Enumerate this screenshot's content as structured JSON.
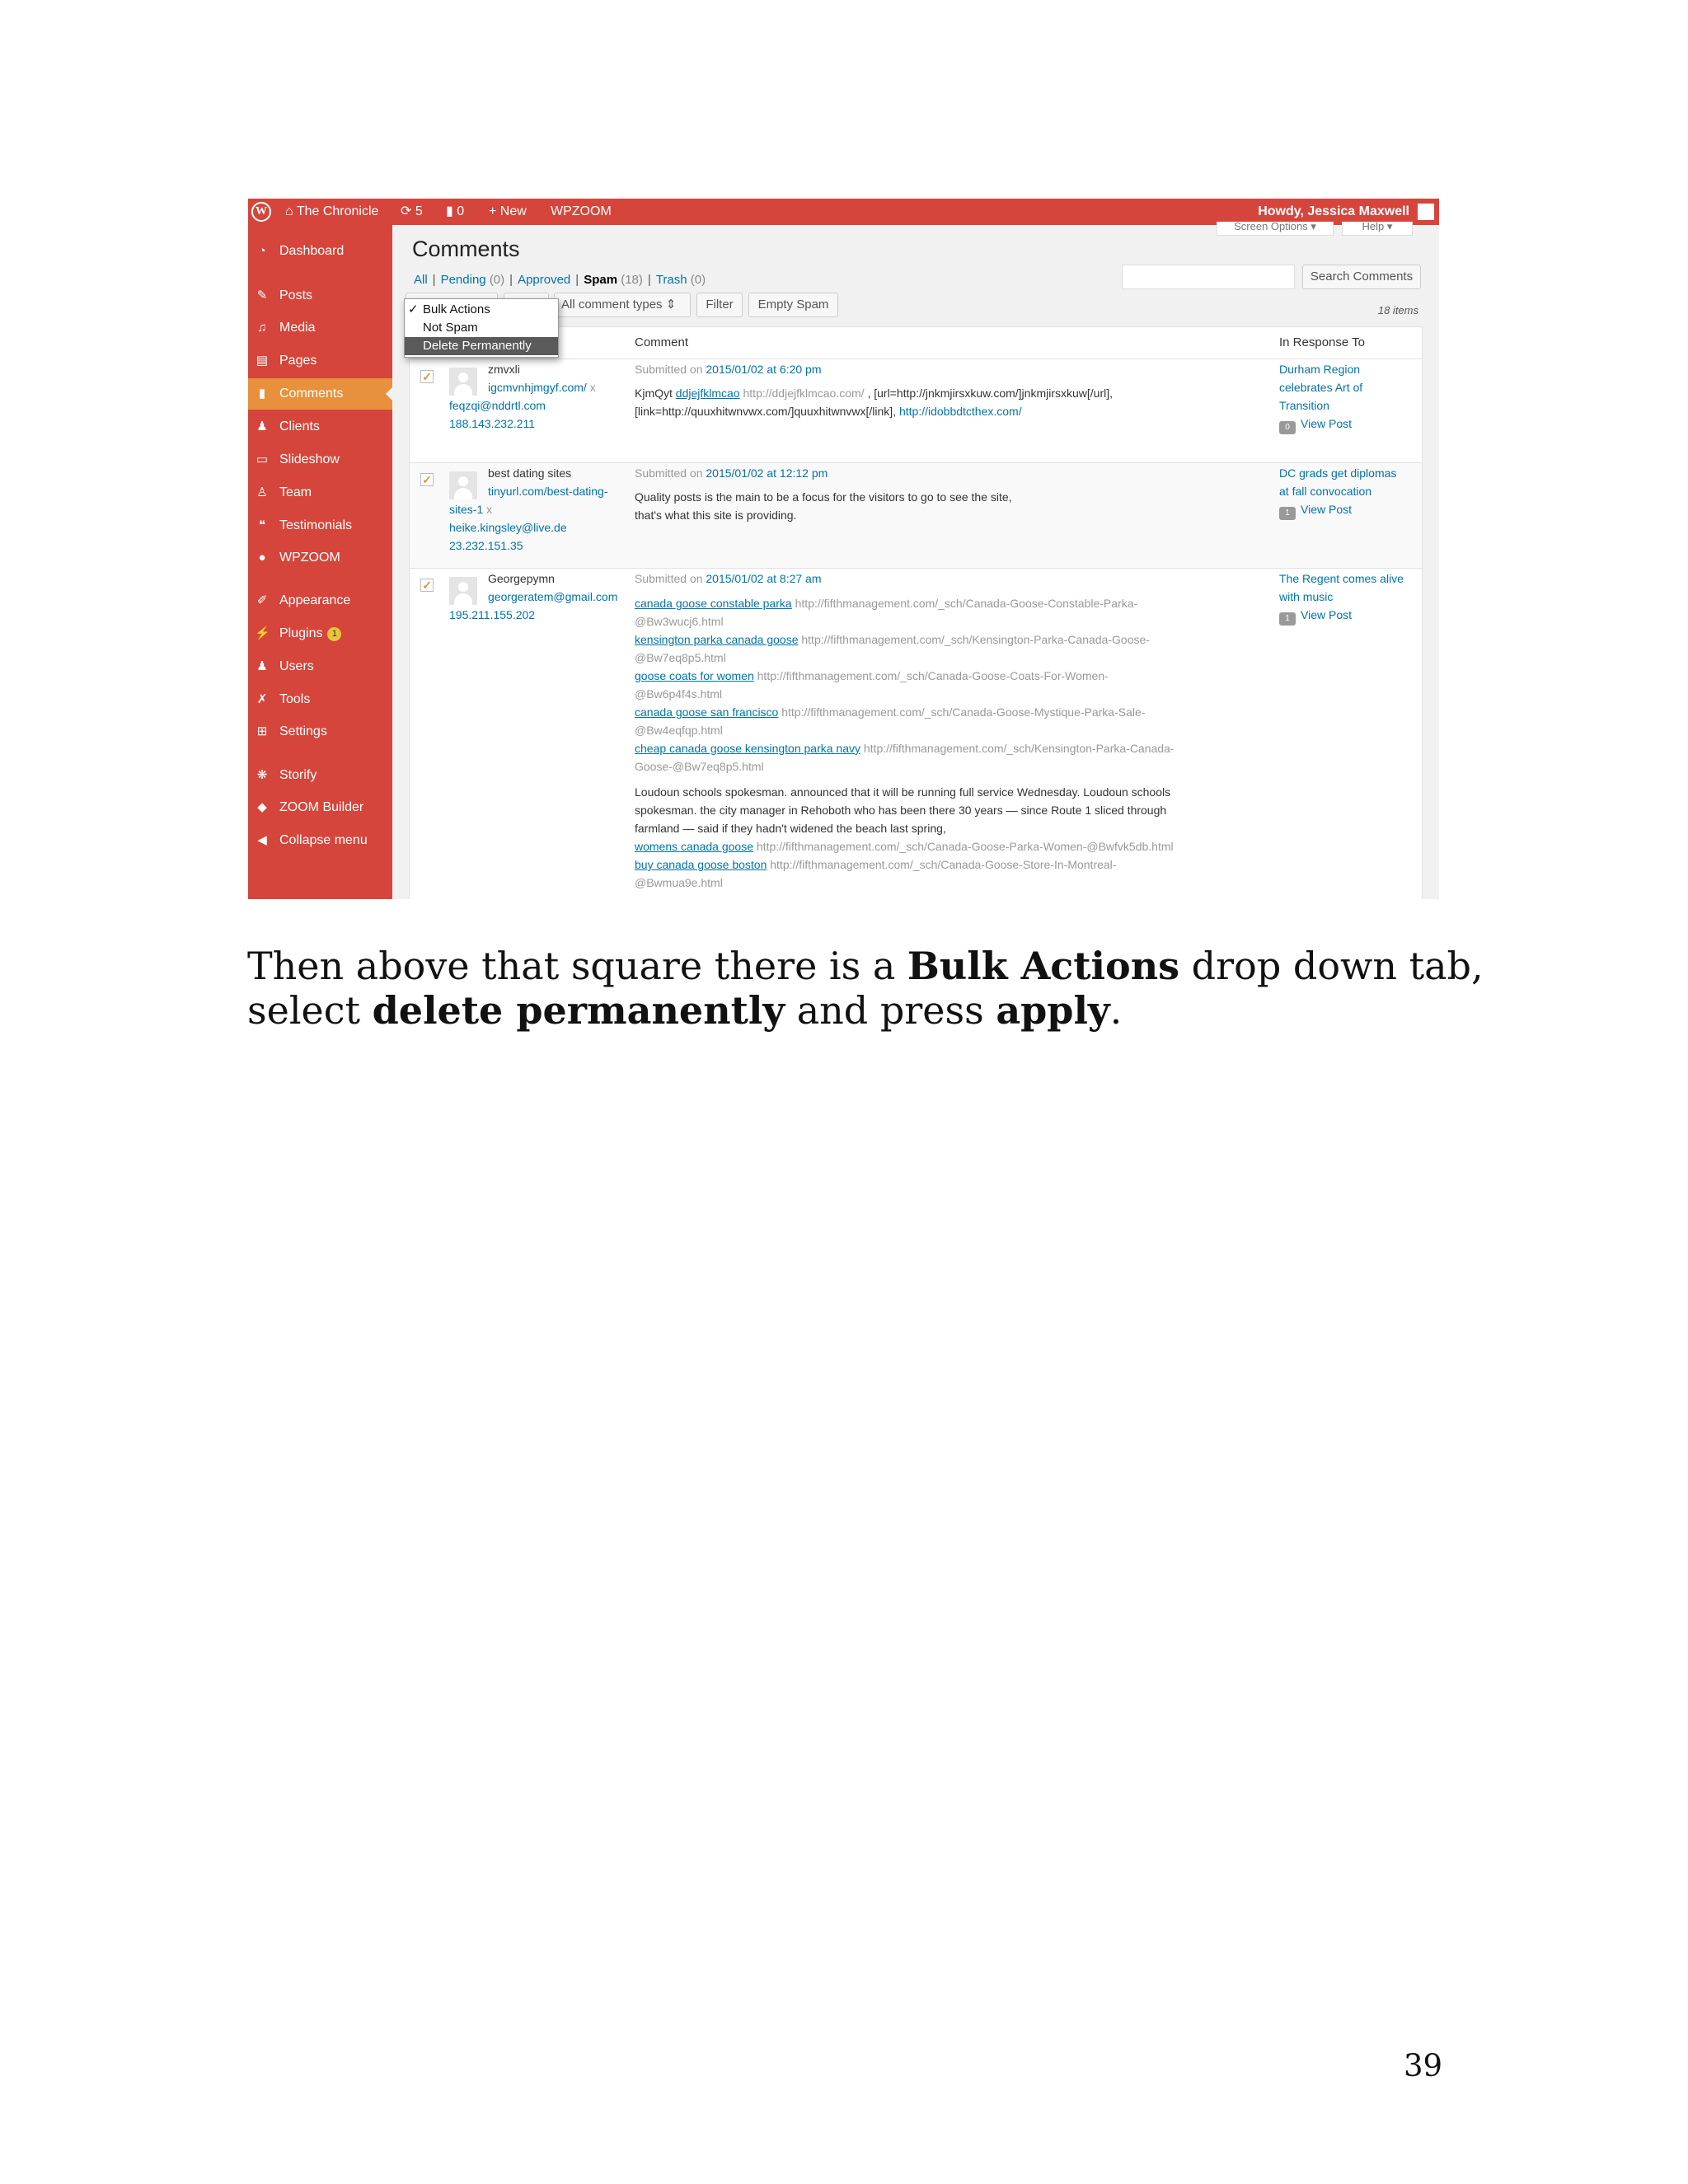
{
  "adminbar": {
    "site": "The Chronicle",
    "updates": "5",
    "comments": "0",
    "new": "New",
    "wpzoom": "WPZOOM",
    "howdy": "Howdy, Jessica Maxwell"
  },
  "sidebar": {
    "items": [
      {
        "label": "Dashboard",
        "icon": "dashboard-icon"
      },
      {
        "label": "Posts",
        "icon": "pin-icon"
      },
      {
        "label": "Media",
        "icon": "media-icon"
      },
      {
        "label": "Pages",
        "icon": "pages-icon"
      },
      {
        "label": "Comments",
        "icon": "comment-icon"
      },
      {
        "label": "Clients",
        "icon": "clients-icon"
      },
      {
        "label": "Slideshow",
        "icon": "slideshow-icon"
      },
      {
        "label": "Team",
        "icon": "team-icon"
      },
      {
        "label": "Testimonials",
        "icon": "quote-icon"
      },
      {
        "label": "WPZOOM",
        "icon": "wpzoom-icon"
      },
      {
        "label": "Appearance",
        "icon": "brush-icon"
      },
      {
        "label": "Plugins",
        "icon": "plugin-icon",
        "badge": "1"
      },
      {
        "label": "Users",
        "icon": "user-icon"
      },
      {
        "label": "Tools",
        "icon": "wrench-icon"
      },
      {
        "label": "Settings",
        "icon": "settings-icon"
      },
      {
        "label": "Storify",
        "icon": "storify-icon"
      },
      {
        "label": "ZOOM Builder",
        "icon": "builder-icon"
      },
      {
        "label": "Collapse menu",
        "icon": "collapse-icon"
      }
    ]
  },
  "screen_options": "Screen Options",
  "help": "Help",
  "page_title": "Comments",
  "filters": {
    "all": "All",
    "pending": "Pending",
    "pending_count": "(0)",
    "approved": "Approved",
    "spam": "Spam",
    "spam_count": "(18)",
    "trash": "Trash",
    "trash_count": "(0)"
  },
  "search_button": "Search Comments",
  "bulk": {
    "options": [
      "Bulk Actions",
      "Not Spam",
      "Delete Permanently"
    ],
    "selected": "Delete Permanently",
    "apply": "Apply"
  },
  "comment_type": "All comment types",
  "filter_button": "Filter",
  "empty_spam": "Empty Spam",
  "items_count": "18 items",
  "columns": {
    "comment": "Comment",
    "response": "In Response To"
  },
  "rows": [
    {
      "author": "zmvxli",
      "url": "igcmvnhjmgyf.com/",
      "email": "feqzqi@nddrtl.com",
      "ip": "188.143.232.211",
      "submitted": "Submitted on",
      "date": "2015/01/02 at 6:20 pm",
      "l1a": "KjmQyt",
      "l1b": "ddjejfklmcao",
      "l1c": "http://ddjejfklmcao.com/",
      "l1d": ", [url=http://jnkmjirsxkuw.com/]jnkmjirsxkuw[/url],",
      "l2a": "[link=http://quuxhitwnvwx.com/]quuxhitwnvwx[/link],",
      "l2b": "http://idobbdtcthex.com/",
      "response": [
        "Durham Region",
        "celebrates Art of",
        "Transition"
      ],
      "bubble": "0",
      "view": "View Post"
    },
    {
      "author": "best dating sites",
      "url1": "tinyurl.com/best-dating-",
      "url2": "sites-1",
      "email": "heike.kingsley@live.de",
      "ip": "23.232.151.35",
      "submitted": "Submitted on",
      "date": "2015/01/02 at 12:12 pm",
      "text": [
        "Quality posts is the main to be a focus for the visitors to go to see the site,",
        "that's what this site is providing."
      ],
      "response": [
        "DC grads get diplomas",
        "at fall convocation"
      ],
      "bubble": "1",
      "view": "View Post"
    },
    {
      "author": "Georgepymn",
      "email": "georgeratem@gmail.com",
      "ip": "195.211.155.202",
      "submitted": "Submitted on",
      "date": "2015/01/02 at 8:27 am",
      "links": [
        {
          "a": "canada goose constable parka",
          "u1": "http://fifthmanagement.com/_sch/Canada-Goose-Constable-Parka-",
          "u2": "@Bw3wucj6.html"
        },
        {
          "a": "kensington parka canada goose",
          "u1": "http://fifthmanagement.com/_sch/Kensington-Parka-Canada-Goose-",
          "u2": "@Bw7eq8p5.html"
        },
        {
          "a": "goose coats for women",
          "u1": "http://fifthmanagement.com/_sch/Canada-Goose-Coats-For-Women-",
          "u2": "@Bw6p4f4s.html"
        },
        {
          "a": "canada goose san francisco",
          "u1": "http://fifthmanagement.com/_sch/Canada-Goose-Mystique-Parka-Sale-",
          "u2": "@Bw4eqfqp.html"
        },
        {
          "a": "cheap canada goose kensington parka navy",
          "u1": "http://fifthmanagement.com/_sch/Kensington-Parka-Canada-",
          "u2": "Goose-@Bw7eq8p5.html"
        }
      ],
      "para": [
        "Loudoun schools spokesman. announced that it will be running full service Wednesday. Loudoun schools",
        "spokesman. the city manager in Rehoboth who has been there 30 years — since Route 1 sliced through",
        "farmland — said if they hadn't widened the beach last spring,"
      ],
      "links2": [
        {
          "a": "womens canada goose",
          "u": "http://fifthmanagement.com/_sch/Canada-Goose-Parka-Women-@Bwfvk5db.html"
        },
        {
          "a": "buy canada goose boston",
          "u": "http://fifthmanagement.com/_sch/Canada-Goose-Store-In-Montreal-"
        }
      ],
      "cut": "@Bwmua9e.html",
      "response": [
        "The Regent comes alive",
        "with music"
      ],
      "bubble": "1",
      "view": "View Post"
    }
  ],
  "caption": {
    "p1": "Then above that square there is a ",
    "b1": "Bulk Actions",
    "p2": " drop down tab, select ",
    "b2": "delete permanently",
    "p3": " and press ",
    "b3": "apply",
    "p4": "."
  },
  "page_number": "39"
}
